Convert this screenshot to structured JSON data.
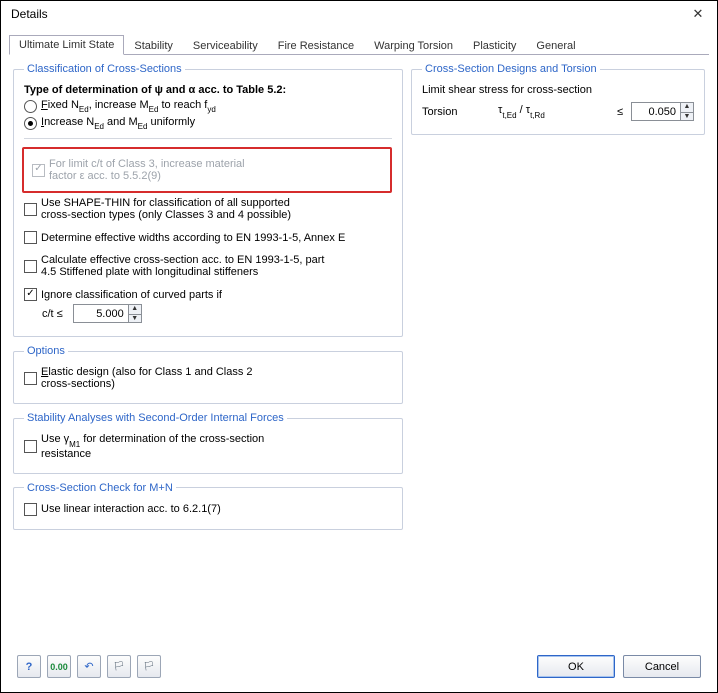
{
  "window": {
    "title": "Details"
  },
  "tabs": [
    "Ultimate Limit State",
    "Stability",
    "Serviceability",
    "Fire Resistance",
    "Warping Torsion",
    "Plasticity",
    "General"
  ],
  "active_tab": 0,
  "classification": {
    "legend": "Classification of Cross-Sections",
    "heading": "Type of determination of ψ and α acc. to Table 5.2:",
    "opt_fixed_pre": "Fixed N",
    "opt_fixed_sub1": "Ed",
    "opt_fixed_mid": ", increase M",
    "opt_fixed_sub2": "Ed",
    "opt_fixed_mid2": " to reach f",
    "opt_fixed_sub3": "yd",
    "opt_incr_pre": "Increase N",
    "opt_incr_sub1": "Ed",
    "opt_incr_mid": " and M",
    "opt_incr_sub2": "Ed",
    "opt_incr_post": " uniformly",
    "class3_line1": "For limit c/t of Class 3, increase material",
    "class3_line2": "factor ε acc. to 5.5.2(9)",
    "shape_thin_1": "Use SHAPE-THIN for classification of all supported",
    "shape_thin_2": "cross-section types (only Classes 3 and 4 possible)",
    "eff_widths": "Determine effective widths according to EN 1993-1-5, Annex E",
    "calc_eff_1": "Calculate effective cross-section acc. to EN 1993-1-5, part",
    "calc_eff_2": "4.5 Stiffened plate with longitudinal stiffeners",
    "ignore_curved": "Ignore classification of curved parts if",
    "ct_label": "c/t ≤",
    "ct_value": "5.000"
  },
  "options": {
    "legend": "Options",
    "elastic_1": "Elastic design (also for Class 1 and Class 2",
    "elastic_2": "cross-sections)"
  },
  "stability": {
    "legend": "Stability Analyses with Second-Order Internal Forces",
    "gamma_pre": "Use γ",
    "gamma_sub": "M1",
    "gamma_post_1": " for determination of the cross-section",
    "gamma_post_2": "resistance"
  },
  "mn_check": {
    "legend": "Cross-Section Check for M+N",
    "linear": "Use linear interaction acc. to 6.2.1(7)"
  },
  "torsion": {
    "legend": "Cross-Section Designs and Torsion",
    "shear": "Limit shear stress for cross-section",
    "torsion_label": "Torsion",
    "ratio_pre": "τ",
    "ratio_sub1": "t,Ed",
    "ratio_mid": " / τ",
    "ratio_sub2": "t,Rd",
    "le": "≤",
    "value": "0.050"
  },
  "buttons": {
    "ok": "OK",
    "cancel": "Cancel"
  }
}
